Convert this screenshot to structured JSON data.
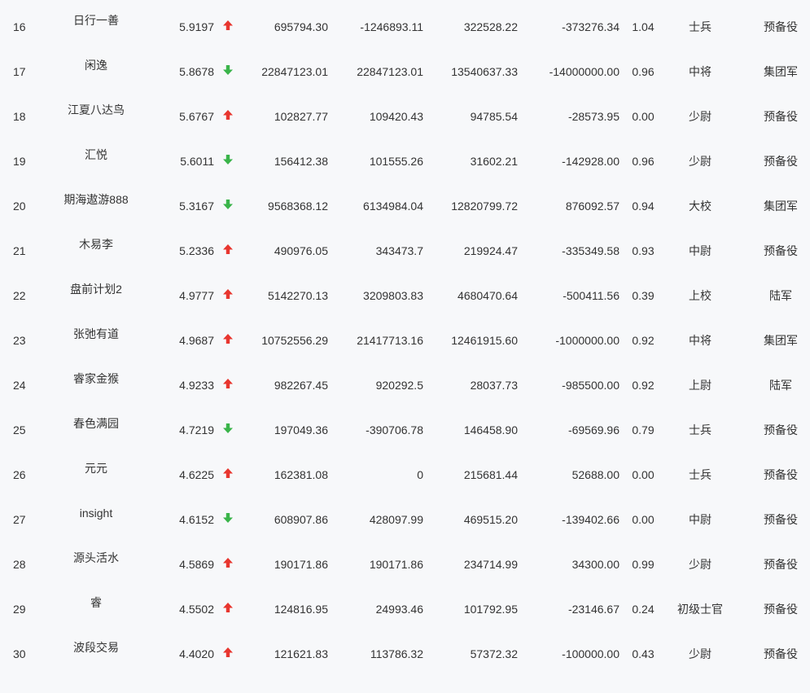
{
  "colors": {
    "up": "#e8362f",
    "down": "#3ab44a",
    "text": "#333333",
    "background": "#f7f8fa"
  },
  "rows": [
    {
      "rank": "16",
      "name": "日行一善",
      "score": "5.9197",
      "trend": "up",
      "v1": "695794.30",
      "v2": "-1246893.11",
      "v3": "322528.22",
      "v4": "-373276.34",
      "ratio": "1.04",
      "rank_title": "士兵",
      "group": "预备役"
    },
    {
      "rank": "17",
      "name": "闲逸",
      "score": "5.8678",
      "trend": "down",
      "v1": "22847123.01",
      "v2": "22847123.01",
      "v3": "13540637.33",
      "v4": "-14000000.00",
      "ratio": "0.96",
      "rank_title": "中将",
      "group": "集团军"
    },
    {
      "rank": "18",
      "name": "江夏八达鸟",
      "score": "5.6767",
      "trend": "up",
      "v1": "102827.77",
      "v2": "109420.43",
      "v3": "94785.54",
      "v4": "-28573.95",
      "ratio": "0.00",
      "rank_title": "少尉",
      "group": "预备役"
    },
    {
      "rank": "19",
      "name": "汇悦",
      "score": "5.6011",
      "trend": "down",
      "v1": "156412.38",
      "v2": "101555.26",
      "v3": "31602.21",
      "v4": "-142928.00",
      "ratio": "0.96",
      "rank_title": "少尉",
      "group": "预备役"
    },
    {
      "rank": "20",
      "name": "期海遨游888",
      "score": "5.3167",
      "trend": "down",
      "v1": "9568368.12",
      "v2": "6134984.04",
      "v3": "12820799.72",
      "v4": "876092.57",
      "ratio": "0.94",
      "rank_title": "大校",
      "group": "集团军"
    },
    {
      "rank": "21",
      "name": "木易李",
      "score": "5.2336",
      "trend": "up",
      "v1": "490976.05",
      "v2": "343473.7",
      "v3": "219924.47",
      "v4": "-335349.58",
      "ratio": "0.93",
      "rank_title": "中尉",
      "group": "预备役"
    },
    {
      "rank": "22",
      "name": "盘前计划2",
      "score": "4.9777",
      "trend": "up",
      "v1": "5142270.13",
      "v2": "3209803.83",
      "v3": "4680470.64",
      "v4": "-500411.56",
      "ratio": "0.39",
      "rank_title": "上校",
      "group": "陆军"
    },
    {
      "rank": "23",
      "name": "张弛有道",
      "score": "4.9687",
      "trend": "up",
      "v1": "10752556.29",
      "v2": "21417713.16",
      "v3": "12461915.60",
      "v4": "-1000000.00",
      "ratio": "0.92",
      "rank_title": "中将",
      "group": "集团军"
    },
    {
      "rank": "24",
      "name": "睿家金猴",
      "score": "4.9233",
      "trend": "up",
      "v1": "982267.45",
      "v2": "920292.5",
      "v3": "28037.73",
      "v4": "-985500.00",
      "ratio": "0.92",
      "rank_title": "上尉",
      "group": "陆军"
    },
    {
      "rank": "25",
      "name": "春色满园",
      "score": "4.7219",
      "trend": "down",
      "v1": "197049.36",
      "v2": "-390706.78",
      "v3": "146458.90",
      "v4": "-69569.96",
      "ratio": "0.79",
      "rank_title": "士兵",
      "group": "预备役"
    },
    {
      "rank": "26",
      "name": "元元",
      "score": "4.6225",
      "trend": "up",
      "v1": "162381.08",
      "v2": "0",
      "v3": "215681.44",
      "v4": "52688.00",
      "ratio": "0.00",
      "rank_title": "士兵",
      "group": "预备役"
    },
    {
      "rank": "27",
      "name": "insight",
      "score": "4.6152",
      "trend": "down",
      "v1": "608907.86",
      "v2": "428097.99",
      "v3": "469515.20",
      "v4": "-139402.66",
      "ratio": "0.00",
      "rank_title": "中尉",
      "group": "预备役"
    },
    {
      "rank": "28",
      "name": "源头活水",
      "score": "4.5869",
      "trend": "up",
      "v1": "190171.86",
      "v2": "190171.86",
      "v3": "234714.99",
      "v4": "34300.00",
      "ratio": "0.99",
      "rank_title": "少尉",
      "group": "预备役"
    },
    {
      "rank": "29",
      "name": "睿",
      "score": "4.5502",
      "trend": "up",
      "v1": "124816.95",
      "v2": "24993.46",
      "v3": "101792.95",
      "v4": "-23146.67",
      "ratio": "0.24",
      "rank_title": "初级士官",
      "group": "预备役"
    },
    {
      "rank": "30",
      "name": "波段交易",
      "score": "4.4020",
      "trend": "up",
      "v1": "121621.83",
      "v2": "113786.32",
      "v3": "57372.32",
      "v4": "-100000.00",
      "ratio": "0.43",
      "rank_title": "少尉",
      "group": "预备役"
    }
  ]
}
